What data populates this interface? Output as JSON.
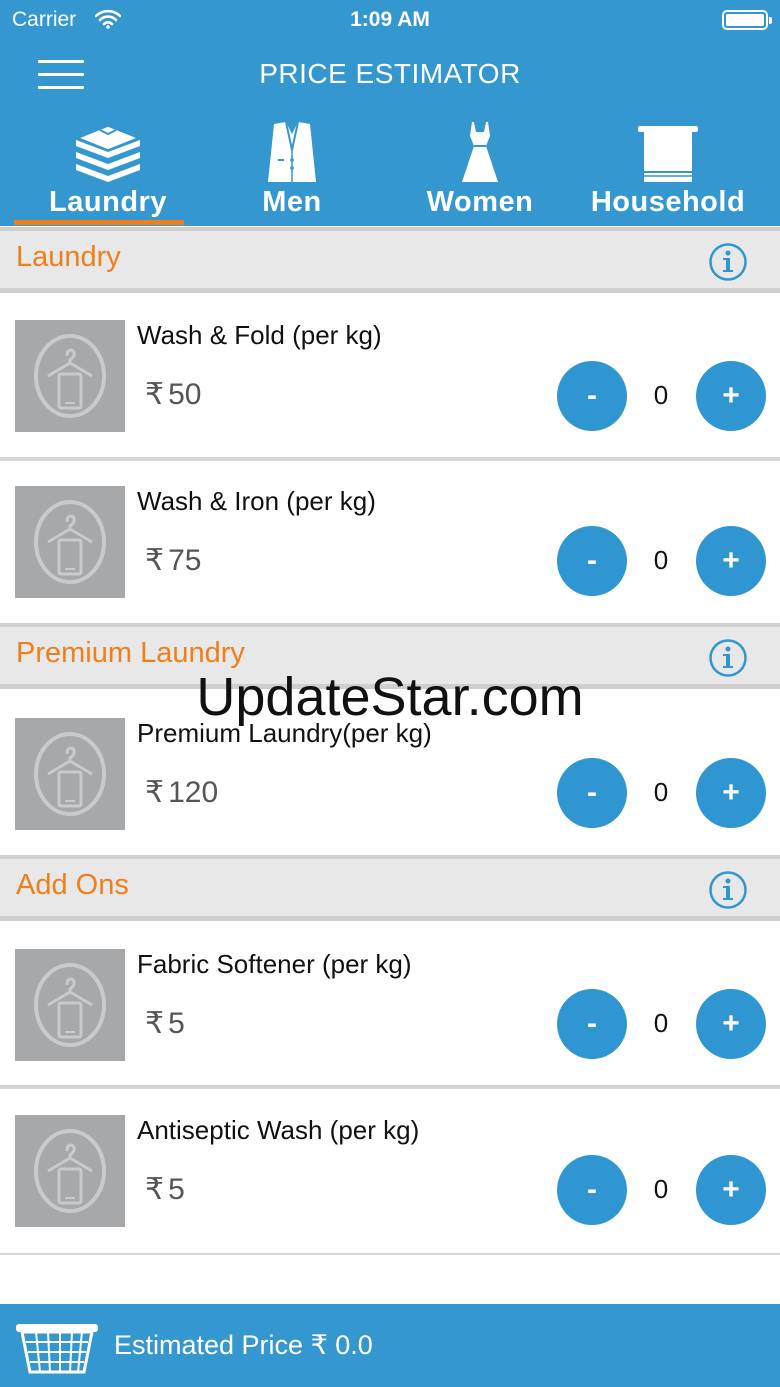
{
  "status_bar": {
    "carrier": "Carrier",
    "time": "1:09 AM"
  },
  "header": {
    "title": "PRICE ESTIMATOR"
  },
  "tabs": [
    {
      "label": "Laundry",
      "icon": "folded-clothes-icon",
      "active": true
    },
    {
      "label": "Men",
      "icon": "suit-icon",
      "active": false
    },
    {
      "label": "Women",
      "icon": "dress-icon",
      "active": false
    },
    {
      "label": "Household",
      "icon": "towel-icon",
      "active": false
    }
  ],
  "sections": [
    {
      "title": "Laundry",
      "items": [
        {
          "name": "Wash & Fold (per kg)",
          "price": "50",
          "qty": "0"
        },
        {
          "name": "Wash & Iron (per kg)",
          "price": "75",
          "qty": "0"
        }
      ]
    },
    {
      "title": "Premium Laundry",
      "items": [
        {
          "name": "Premium Laundry(per kg)",
          "price": "120",
          "qty": "0"
        }
      ]
    },
    {
      "title": "Add Ons",
      "items": [
        {
          "name": "Fabric Softener (per kg)",
          "price": "5",
          "qty": "0"
        },
        {
          "name": "Antiseptic Wash (per kg)",
          "price": "5",
          "qty": "0"
        }
      ]
    }
  ],
  "buttons": {
    "minus": "-",
    "plus": "+"
  },
  "currency": "₹",
  "footer": {
    "label": "Estimated Price ₹ 0.0"
  },
  "watermark": "UpdateStar.com",
  "colors": {
    "header": "#3497cf",
    "accent": "#ef7f1a",
    "button": "#2f96d2"
  }
}
